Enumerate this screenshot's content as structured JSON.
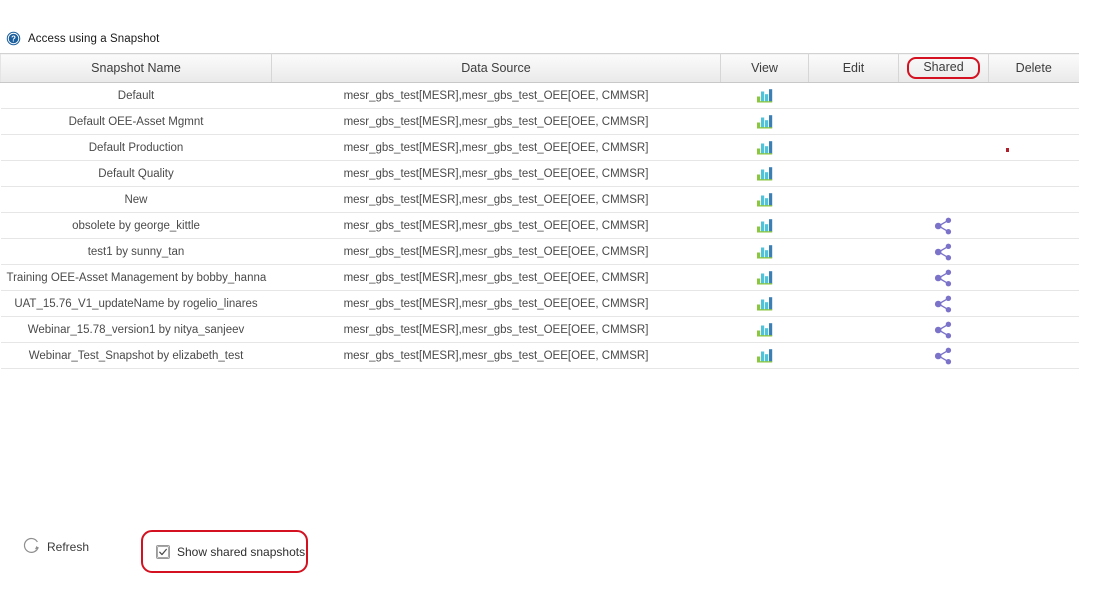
{
  "section": {
    "title": "Access using a Snapshot",
    "help_icon": "help-circle-icon"
  },
  "table": {
    "columns": [
      {
        "key": "name",
        "label": "Snapshot Name"
      },
      {
        "key": "source",
        "label": "Data Source"
      },
      {
        "key": "view",
        "label": "View"
      },
      {
        "key": "edit",
        "label": "Edit"
      },
      {
        "key": "shared",
        "label": "Shared"
      },
      {
        "key": "delete",
        "label": "Delete"
      }
    ],
    "rows": [
      {
        "name": "Default",
        "source": "mesr_gbs_test[MESR],mesr_gbs_test_OEE[OEE, CMMSR]",
        "view": "bar-chart-icon",
        "edit": "",
        "shared": "",
        "delete": ""
      },
      {
        "name": "Default OEE-Asset Mgmnt",
        "source": "mesr_gbs_test[MESR],mesr_gbs_test_OEE[OEE, CMMSR]",
        "view": "bar-chart-icon",
        "edit": "",
        "shared": "",
        "delete": ""
      },
      {
        "name": "Default Production",
        "source": "mesr_gbs_test[MESR],mesr_gbs_test_OEE[OEE, CMMSR]",
        "view": "bar-chart-icon",
        "edit": "",
        "shared": "",
        "delete": ""
      },
      {
        "name": "Default Quality",
        "source": "mesr_gbs_test[MESR],mesr_gbs_test_OEE[OEE, CMMSR]",
        "view": "bar-chart-icon",
        "edit": "",
        "shared": "",
        "delete": ""
      },
      {
        "name": "New",
        "source": "mesr_gbs_test[MESR],mesr_gbs_test_OEE[OEE, CMMSR]",
        "view": "bar-chart-icon",
        "edit": "",
        "shared": "",
        "delete": ""
      },
      {
        "name": "obsolete by george_kittle",
        "source": "mesr_gbs_test[MESR],mesr_gbs_test_OEE[OEE, CMMSR]",
        "view": "bar-chart-icon",
        "edit": "",
        "shared": "share-nodes-icon",
        "delete": ""
      },
      {
        "name": "test1 by sunny_tan",
        "source": "mesr_gbs_test[MESR],mesr_gbs_test_OEE[OEE, CMMSR]",
        "view": "bar-chart-icon",
        "edit": "",
        "shared": "share-nodes-icon",
        "delete": ""
      },
      {
        "name": "Training OEE-Asset Management by bobby_hanna",
        "source": "mesr_gbs_test[MESR],mesr_gbs_test_OEE[OEE, CMMSR]",
        "view": "bar-chart-icon",
        "edit": "",
        "shared": "share-nodes-icon",
        "delete": ""
      },
      {
        "name": "UAT_15.76_V1_updateName by rogelio_linares",
        "source": "mesr_gbs_test[MESR],mesr_gbs_test_OEE[OEE, CMMSR]",
        "view": "bar-chart-icon",
        "edit": "",
        "shared": "share-nodes-icon",
        "delete": ""
      },
      {
        "name": "Webinar_15.78_version1 by nitya_sanjeev",
        "source": "mesr_gbs_test[MESR],mesr_gbs_test_OEE[OEE, CMMSR]",
        "view": "bar-chart-icon",
        "edit": "",
        "shared": "share-nodes-icon",
        "delete": ""
      },
      {
        "name": "Webinar_Test_Snapshot by elizabeth_test",
        "source": "mesr_gbs_test[MESR],mesr_gbs_test_OEE[OEE, CMMSR]",
        "view": "bar-chart-icon",
        "edit": "",
        "shared": "share-nodes-icon",
        "delete": ""
      }
    ]
  },
  "footer": {
    "refresh_label": "Refresh",
    "refresh_icon": "refresh-circular-arrow-icon",
    "show_shared_label": "Show shared snapshots",
    "show_shared_checked": true
  },
  "annotations": {
    "shared_header_highlight_color": "#d41120",
    "checkbox_highlight_color": "#d41120"
  },
  "colors": {
    "help_icon_blue": "#1b5f9e",
    "chart_bar_green": "#8cc63f",
    "chart_bar_cyan": "#4ec3d9",
    "chart_bar_blue": "#3b7fb5",
    "share_node_purple": "#7b73c9",
    "header_text": "#3c3c3c",
    "row_text": "#4a4a4a"
  }
}
